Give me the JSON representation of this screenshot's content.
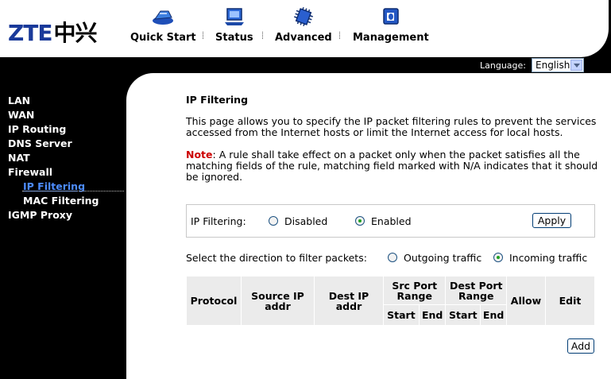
{
  "brand": {
    "logo_latin": "ZTE",
    "logo_cn": "中兴"
  },
  "topnav": {
    "items": [
      {
        "label": "Quick Start",
        "icon": "quick-start-icon"
      },
      {
        "label": "Status",
        "icon": "status-icon"
      },
      {
        "label": "Advanced",
        "icon": "advanced-icon"
      },
      {
        "label": "Management",
        "icon": "management-icon"
      }
    ]
  },
  "language": {
    "label": "Language:",
    "value": "English"
  },
  "sidebar": {
    "items": [
      {
        "label": "LAN"
      },
      {
        "label": "WAN"
      },
      {
        "label": "IP Routing"
      },
      {
        "label": "DNS Server"
      },
      {
        "label": "NAT"
      },
      {
        "label": "Firewall"
      },
      {
        "label": "IP Filtering",
        "active": true
      },
      {
        "label": "MAC Filtering"
      },
      {
        "label": "IGMP Proxy"
      }
    ]
  },
  "main": {
    "title": "IP Filtering",
    "description": "This page allows you to specify the IP packet filtering rules to prevent the services accessed from the Internet hosts or limit the Internet access for local hosts.",
    "note_label": "Note",
    "note_text": ": A rule shall take effect on a packet only when the packet satisfies all the matching fields of the rule, matching field marked with N/A indicates that it should be ignored.",
    "filter": {
      "label": "IP Filtering:",
      "options": [
        "Disabled",
        "Enabled"
      ],
      "selected": "Enabled",
      "apply_label": "Apply"
    },
    "direction": {
      "label": "Select the direction to filter packets:",
      "options": [
        "Outgoing traffic",
        "Incoming traffic"
      ],
      "selected": "Incoming traffic"
    },
    "table": {
      "headers": {
        "protocol": "Protocol",
        "source_ip": "Source IP addr",
        "dest_ip": "Dest IP addr",
        "src_port": "Src Port Range",
        "dest_port": "Dest Port Range",
        "allow": "Allow",
        "edit": "Edit",
        "start": "Start",
        "end": "End"
      }
    },
    "add_label": "Add"
  },
  "colors": {
    "accent": "#4d8cff",
    "brand_blue": "#1a3a9a",
    "note_red": "#cc0000",
    "selected_radio": "#21a121"
  }
}
